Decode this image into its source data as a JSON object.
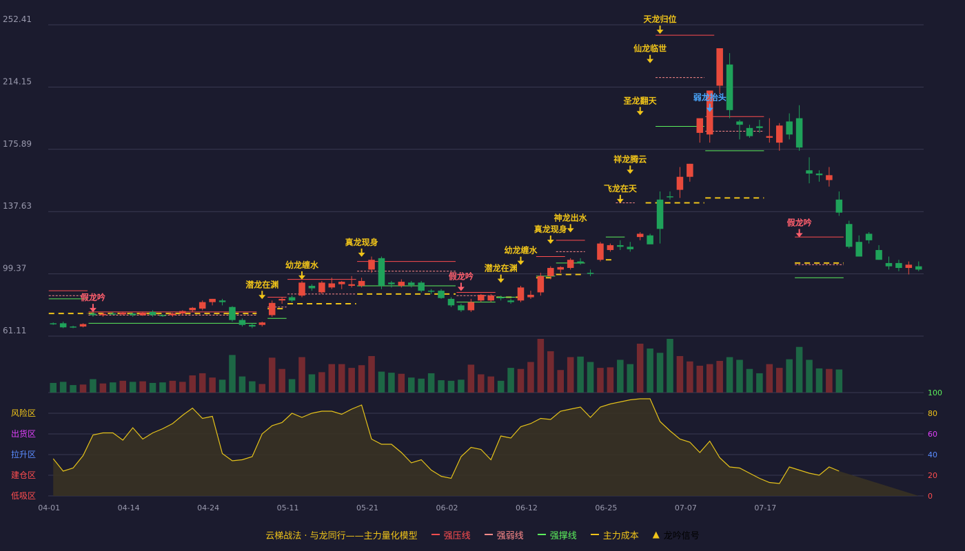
{
  "legend": {
    "title": "云梯战法 · 与龙同行——主力量化模型",
    "items": [
      {
        "label": "强压线",
        "color": "#ff4d4f",
        "style": "solid"
      },
      {
        "label": "强弱线",
        "color": "#ff8a8a",
        "style": "dashed"
      },
      {
        "label": "强撑线",
        "color": "#5cf05c",
        "style": "solid"
      },
      {
        "label": "主力成本",
        "color": "#f0c419",
        "style": "dashed"
      },
      {
        "label": "龙吟信号",
        "color": "#f0c419",
        "symbol": "▲"
      }
    ]
  },
  "colors": {
    "background": "#1b1b2e",
    "up": "#e84a3c",
    "down": "#1fa25a",
    "grid": "#3a3a52",
    "axis_text": "#9a9aae",
    "signal": "#f0c419",
    "fake_signal": "#ff5f6d",
    "weak_signal": "#4aa8ff",
    "oscillator": "#e6c31a"
  },
  "chart_data": {
    "type": "candlestick",
    "y_ticks": [
      "252.41",
      "214.15",
      "175.89",
      "137.63",
      "99.37",
      "61.11"
    ],
    "ylim": [
      61.11,
      252.41
    ],
    "x_tick_labels": [
      {
        "label": "04-01",
        "index": 0
      },
      {
        "label": "04-14",
        "index": 8
      },
      {
        "label": "04-24",
        "index": 16
      },
      {
        "label": "05-11",
        "index": 24
      },
      {
        "label": "05-21",
        "index": 32
      },
      {
        "label": "06-02",
        "index": 40
      },
      {
        "label": "06-12",
        "index": 48
      },
      {
        "label": "06-25",
        "index": 56
      },
      {
        "label": "07-07",
        "index": 64
      },
      {
        "label": "07-17",
        "index": 72
      }
    ],
    "ohlc": [
      [
        69,
        69.5,
        68,
        68.5
      ],
      [
        69,
        70,
        66,
        66.5
      ],
      [
        67,
        67.5,
        66,
        66.8
      ],
      [
        67,
        69,
        66.5,
        68.5
      ],
      [
        75,
        76,
        73,
        74
      ],
      [
        74,
        75.5,
        73,
        74.8
      ],
      [
        75,
        76,
        74,
        74.5
      ],
      [
        74.5,
        76,
        74,
        75.5
      ],
      [
        75,
        75.5,
        73,
        74
      ],
      [
        74,
        76,
        73.5,
        75.5
      ],
      [
        76,
        77,
        73,
        74
      ],
      [
        74,
        74.5,
        73,
        73.5
      ],
      [
        74,
        75.5,
        73,
        75
      ],
      [
        75,
        77,
        74,
        76.5
      ],
      [
        77,
        79,
        76,
        78.5
      ],
      [
        78,
        83,
        77,
        82
      ],
      [
        82,
        84,
        80,
        84
      ],
      [
        83,
        84,
        80,
        82
      ],
      [
        79,
        79.5,
        70,
        71
      ],
      [
        71,
        72,
        67,
        68
      ],
      [
        68,
        69,
        66,
        67
      ],
      [
        68,
        70,
        67,
        69.5
      ],
      [
        74,
        83,
        73,
        81.5
      ],
      [
        83,
        85,
        81,
        84
      ],
      [
        85,
        86,
        82,
        83
      ],
      [
        86,
        95,
        85,
        94
      ],
      [
        92,
        93,
        89,
        90.5
      ],
      [
        88,
        95,
        87,
        94
      ],
      [
        91,
        97,
        90,
        93.5
      ],
      [
        93,
        95,
        90,
        94.5
      ],
      [
        92,
        98,
        91,
        93
      ],
      [
        92,
        97,
        91,
        95
      ],
      [
        102,
        110,
        100,
        108
      ],
      [
        109,
        110,
        90,
        92
      ],
      [
        94,
        95,
        91,
        93
      ],
      [
        92,
        96,
        91,
        94.5
      ],
      [
        94,
        95,
        91,
        92.5
      ],
      [
        94,
        95,
        88,
        89
      ],
      [
        89,
        90,
        87,
        88.5
      ],
      [
        89,
        90,
        84,
        84.5
      ],
      [
        84,
        85,
        79,
        80
      ],
      [
        80,
        81,
        76,
        77
      ],
      [
        77,
        84,
        76,
        82
      ],
      [
        83,
        87,
        82,
        86.5
      ],
      [
        83,
        87,
        82,
        86
      ],
      [
        85,
        86,
        83,
        84.5
      ],
      [
        83,
        84,
        81,
        82
      ],
      [
        83,
        92,
        82,
        91
      ],
      [
        85,
        89,
        84,
        86.5
      ],
      [
        88,
        100,
        86,
        98
      ],
      [
        98,
        104,
        96,
        103
      ],
      [
        102,
        104,
        100,
        103.5
      ],
      [
        103,
        109,
        102,
        108
      ],
      [
        107,
        109,
        105,
        106
      ],
      [
        100,
        102,
        98,
        99.5
      ],
      [
        108,
        119,
        107,
        118
      ],
      [
        114,
        118,
        113,
        117
      ],
      [
        117,
        120,
        114,
        116
      ],
      [
        116,
        119,
        113,
        114.5
      ],
      [
        122,
        125,
        120,
        124
      ],
      [
        123,
        124,
        118,
        117.5
      ],
      [
        145,
        150,
        118,
        127
      ],
      [
        147,
        150,
        145,
        146.5
      ],
      [
        151,
        165,
        146,
        159
      ],
      [
        159,
        167,
        156,
        167
      ],
      [
        186,
        192,
        180,
        195
      ],
      [
        185,
        195,
        180,
        212
      ],
      [
        215,
        225,
        210,
        238
      ],
      [
        228,
        235,
        195,
        200
      ],
      [
        193,
        194,
        182,
        191
      ],
      [
        189,
        191,
        183,
        184
      ],
      [
        190,
        194,
        186,
        189
      ],
      [
        183,
        195,
        180,
        184
      ],
      [
        180,
        192,
        175,
        190.5
      ],
      [
        193,
        198,
        182,
        185
      ],
      [
        195,
        203,
        175,
        177
      ],
      [
        163,
        171,
        155,
        161
      ],
      [
        161,
        163,
        156,
        160
      ],
      [
        157,
        165,
        153,
        160
      ],
      [
        145,
        150,
        135,
        137
      ],
      [
        130,
        132,
        115,
        116
      ],
      [
        119,
        123,
        112,
        110
      ],
      [
        124,
        125,
        118,
        120
      ],
      [
        114,
        117,
        108,
        108
      ],
      [
        106,
        110,
        102,
        104
      ],
      [
        106,
        108,
        101,
        103
      ],
      [
        103,
        107,
        99,
        105
      ],
      [
        104,
        107,
        101,
        102
      ]
    ],
    "volume_relative": [
      0.18,
      0.2,
      0.14,
      0.15,
      0.25,
      0.17,
      0.19,
      0.22,
      0.2,
      0.21,
      0.18,
      0.19,
      0.22,
      0.2,
      0.32,
      0.36,
      0.28,
      0.24,
      0.7,
      0.3,
      0.21,
      0.16,
      0.65,
      0.44,
      0.25,
      0.66,
      0.34,
      0.38,
      0.53,
      0.53,
      0.46,
      0.51,
      0.68,
      0.39,
      0.37,
      0.35,
      0.28,
      0.26,
      0.36,
      0.23,
      0.22,
      0.24,
      0.52,
      0.34,
      0.3,
      0.22,
      0.46,
      0.44,
      0.57,
      1.0,
      0.77,
      0.42,
      0.66,
      0.67,
      0.57,
      0.46,
      0.47,
      0.61,
      0.53,
      0.91,
      0.82,
      0.74,
      1.0,
      0.68,
      0.58,
      0.5,
      0.53,
      0.59,
      0.66,
      0.61,
      0.44,
      0.36,
      0.53,
      0.46,
      0.62,
      0.85,
      0.61,
      0.45,
      0.44,
      0.43
    ],
    "oscillator_zones": [
      {
        "label": "风险区",
        "value": 80,
        "color": "#f0c419"
      },
      {
        "label": "出货区",
        "value": 60,
        "color": "#e040fb"
      },
      {
        "label": "拉升区",
        "value": 40,
        "color": "#5a8cff"
      },
      {
        "label": "建仓区",
        "value": 20,
        "color": "#ff4d4f"
      },
      {
        "label": "低吸区",
        "value": 0,
        "color": "#ff4d4f"
      }
    ],
    "oscillator_ticks": [
      {
        "label": "100",
        "value": 100,
        "color": "#5cf05c"
      },
      {
        "label": "80",
        "value": 80,
        "color": "#f0c419"
      },
      {
        "label": "60",
        "value": 60,
        "color": "#e040fb"
      },
      {
        "label": "40",
        "value": 40,
        "color": "#5a8cff"
      },
      {
        "label": "20",
        "value": 20,
        "color": "#ff4d4f"
      },
      {
        "label": "0",
        "value": 0,
        "color": "#ff4d4f"
      }
    ],
    "oscillator": [
      36,
      24,
      27,
      39,
      59,
      61,
      61,
      54,
      66,
      55,
      61,
      65,
      70,
      78,
      85,
      75,
      77,
      41,
      34,
      35,
      38,
      60,
      68,
      71,
      80,
      76,
      80,
      82,
      82,
      79,
      84,
      88,
      55,
      50,
      50,
      42,
      32,
      35,
      25,
      19,
      17,
      38,
      47,
      45,
      35,
      58,
      56,
      67,
      70,
      75,
      74,
      82,
      84,
      86,
      76,
      86,
      89,
      91,
      93,
      94,
      94,
      72,
      63,
      55,
      52,
      42,
      53,
      37,
      28,
      27,
      22,
      17,
      13,
      12,
      28,
      25,
      22,
      20,
      28,
      24
    ],
    "signals": [
      {
        "label": "假龙吟",
        "index": 4,
        "type": "fake",
        "above": 75
      },
      {
        "label": "潜龙在渊",
        "index": 21,
        "type": "up",
        "above": 83
      },
      {
        "label": "幼龙缠水",
        "index": 25,
        "type": "up",
        "above": 95
      },
      {
        "label": "真龙现身",
        "index": 31,
        "type": "up",
        "above": 109
      },
      {
        "label": "假龙吟",
        "index": 41,
        "type": "fake",
        "above": 88
      },
      {
        "label": "潜龙在渊",
        "index": 45,
        "type": "up",
        "above": 93
      },
      {
        "label": "幼龙缠水",
        "index": 47,
        "type": "up",
        "above": 104
      },
      {
        "label": "真龙现身",
        "index": 50,
        "type": "up",
        "above": 117
      },
      {
        "label": "神龙出水",
        "index": 52,
        "type": "up",
        "above": 124
      },
      {
        "label": "飞龙在天",
        "index": 57,
        "type": "up",
        "above": 142
      },
      {
        "label": "祥龙腾云",
        "index": 58,
        "type": "up",
        "above": 160
      },
      {
        "label": "圣龙翻天",
        "index": 59,
        "type": "up",
        "above": 196
      },
      {
        "label": "仙龙临世",
        "index": 60,
        "type": "up",
        "above": 228
      },
      {
        "label": "天龙归位",
        "index": 61,
        "type": "up",
        "above": 246
      },
      {
        "label": "弱龙抬头",
        "index": 66,
        "type": "weak",
        "above": 198
      },
      {
        "label": "假龙吟",
        "index": 75,
        "type": "fake",
        "above": 121
      }
    ],
    "segments": [
      {
        "type": "pressure",
        "from": 0,
        "to": 3,
        "y": 89
      },
      {
        "type": "weak",
        "from": 0,
        "to": 3,
        "y": 86
      },
      {
        "type": "support",
        "from": 0,
        "to": 3,
        "y": 84
      },
      {
        "type": "cost",
        "from": 0,
        "to": 3,
        "y": 75
      },
      {
        "type": "pressure",
        "from": 4,
        "to": 20,
        "y": 76
      },
      {
        "type": "weak",
        "from": 4,
        "to": 20,
        "y": 74
      },
      {
        "type": "support",
        "from": 4,
        "to": 20,
        "y": 69
      },
      {
        "type": "cost",
        "from": 4,
        "to": 20,
        "y": 75
      },
      {
        "type": "pressure",
        "from": 22,
        "to": 23,
        "y": 85
      },
      {
        "type": "weak",
        "from": 22,
        "to": 23,
        "y": 79
      },
      {
        "type": "support",
        "from": 22,
        "to": 23,
        "y": 72
      },
      {
        "type": "cost",
        "from": 22,
        "to": 23,
        "y": 78
      },
      {
        "type": "pressure",
        "from": 24,
        "to": 30,
        "y": 96
      },
      {
        "type": "weak",
        "from": 24,
        "to": 30,
        "y": 87
      },
      {
        "type": "cost",
        "from": 24,
        "to": 30,
        "y": 81
      },
      {
        "type": "pressure",
        "from": 31,
        "to": 40,
        "y": 107
      },
      {
        "type": "weak",
        "from": 31,
        "to": 40,
        "y": 101
      },
      {
        "type": "support",
        "from": 31,
        "to": 40,
        "y": 92
      },
      {
        "type": "cost",
        "from": 31,
        "to": 40,
        "y": 87
      },
      {
        "type": "pressure",
        "from": 41,
        "to": 44,
        "y": 88
      },
      {
        "type": "weak",
        "from": 41,
        "to": 44,
        "y": 86
      },
      {
        "type": "support",
        "from": 41,
        "to": 44,
        "y": 82
      },
      {
        "type": "cost",
        "from": 45,
        "to": 47,
        "y": 85
      },
      {
        "type": "support",
        "from": 45,
        "to": 46,
        "y": 85
      },
      {
        "type": "pressure",
        "from": 49,
        "to": 51,
        "y": 110
      },
      {
        "type": "support",
        "from": 49,
        "to": 50,
        "y": 98
      },
      {
        "type": "cost",
        "from": 49,
        "to": 50,
        "y": 97
      },
      {
        "type": "pressure",
        "from": 51,
        "to": 53,
        "y": 120
      },
      {
        "type": "weak",
        "from": 51,
        "to": 53,
        "y": 113
      },
      {
        "type": "support",
        "from": 51,
        "to": 53,
        "y": 106
      },
      {
        "type": "cost",
        "from": 51,
        "to": 53,
        "y": 99
      },
      {
        "type": "cost",
        "from": 56,
        "to": 56,
        "y": 108
      },
      {
        "type": "support",
        "from": 56,
        "to": 57,
        "y": 122
      },
      {
        "type": "weak",
        "from": 57,
        "to": 58,
        "y": 143
      },
      {
        "type": "cost",
        "from": 60,
        "to": 65,
        "y": 143
      },
      {
        "type": "pressure",
        "from": 61,
        "to": 66,
        "y": 246
      },
      {
        "type": "weak",
        "from": 61,
        "to": 65,
        "y": 220
      },
      {
        "type": "support",
        "from": 61,
        "to": 65,
        "y": 190
      },
      {
        "type": "cost",
        "from": 66,
        "to": 71,
        "y": 146
      },
      {
        "type": "pressure",
        "from": 66,
        "to": 71,
        "y": 196
      },
      {
        "type": "weak",
        "from": 66,
        "to": 71,
        "y": 187
      },
      {
        "type": "support",
        "from": 66,
        "to": 71,
        "y": 175
      },
      {
        "type": "pressure",
        "from": 75,
        "to": 79,
        "y": 122
      },
      {
        "type": "weak",
        "from": 75,
        "to": 79,
        "y": 105
      },
      {
        "type": "support",
        "from": 75,
        "to": 79,
        "y": 97
      },
      {
        "type": "cost",
        "from": 75,
        "to": 79,
        "y": 106
      }
    ]
  }
}
